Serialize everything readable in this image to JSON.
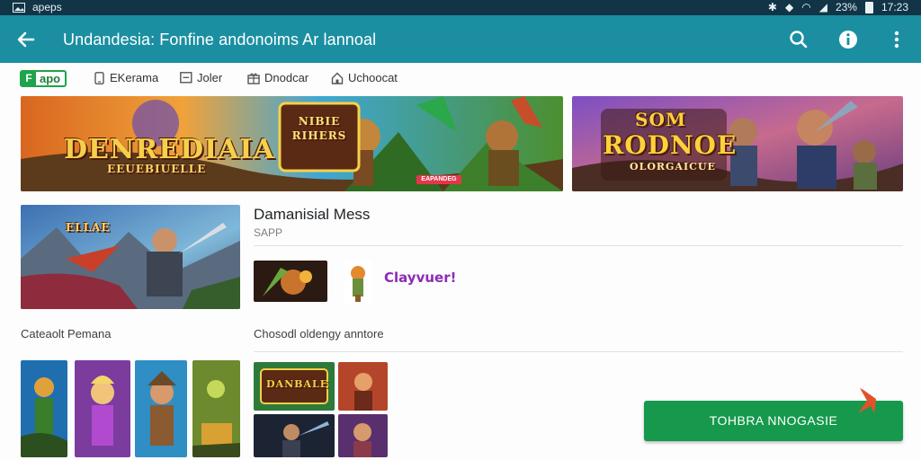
{
  "status_bar": {
    "left_text": "apeps",
    "time": "17:23",
    "battery_pct": "23%"
  },
  "app_bar": {
    "title": "Undandesia: Fonfine andonoims Ar lannoal",
    "icons": [
      "back-arrow-icon",
      "search-icon",
      "info-icon",
      "more-vert-icon"
    ],
    "color": "#1b8fa1"
  },
  "tabs": {
    "badge_label": "apo",
    "items": [
      {
        "label": "EKerama",
        "icon": "phone-icon"
      },
      {
        "label": "Joler",
        "icon": "list-icon"
      },
      {
        "label": "Dnodcar",
        "icon": "gift-icon"
      },
      {
        "label": "Uchoocat",
        "icon": "home-icon"
      }
    ]
  },
  "banners": [
    {
      "title": "DENREDIAIA",
      "subtitle": "EEUEBIUELLE",
      "badge": "NIBIE RIHERS",
      "tag": "EAPANDEG"
    },
    {
      "title": "RODNOE",
      "top": "SOM",
      "subtitle": "OLORGAICUE"
    }
  ],
  "featured": {
    "title": "Damanisial Mess",
    "subtitle": "SAPP",
    "banner_text": "ELLAE",
    "promo_text": "Clayvuer!"
  },
  "sections": {
    "left_label": "Cateaolt Pemana",
    "right_label": "Chosodl oldengy anntore"
  },
  "grid_tiles": {
    "top_left_title": "DANBALE"
  },
  "install_button": {
    "label": "TOHBRA NNOGASIE",
    "color": "#16994d"
  }
}
